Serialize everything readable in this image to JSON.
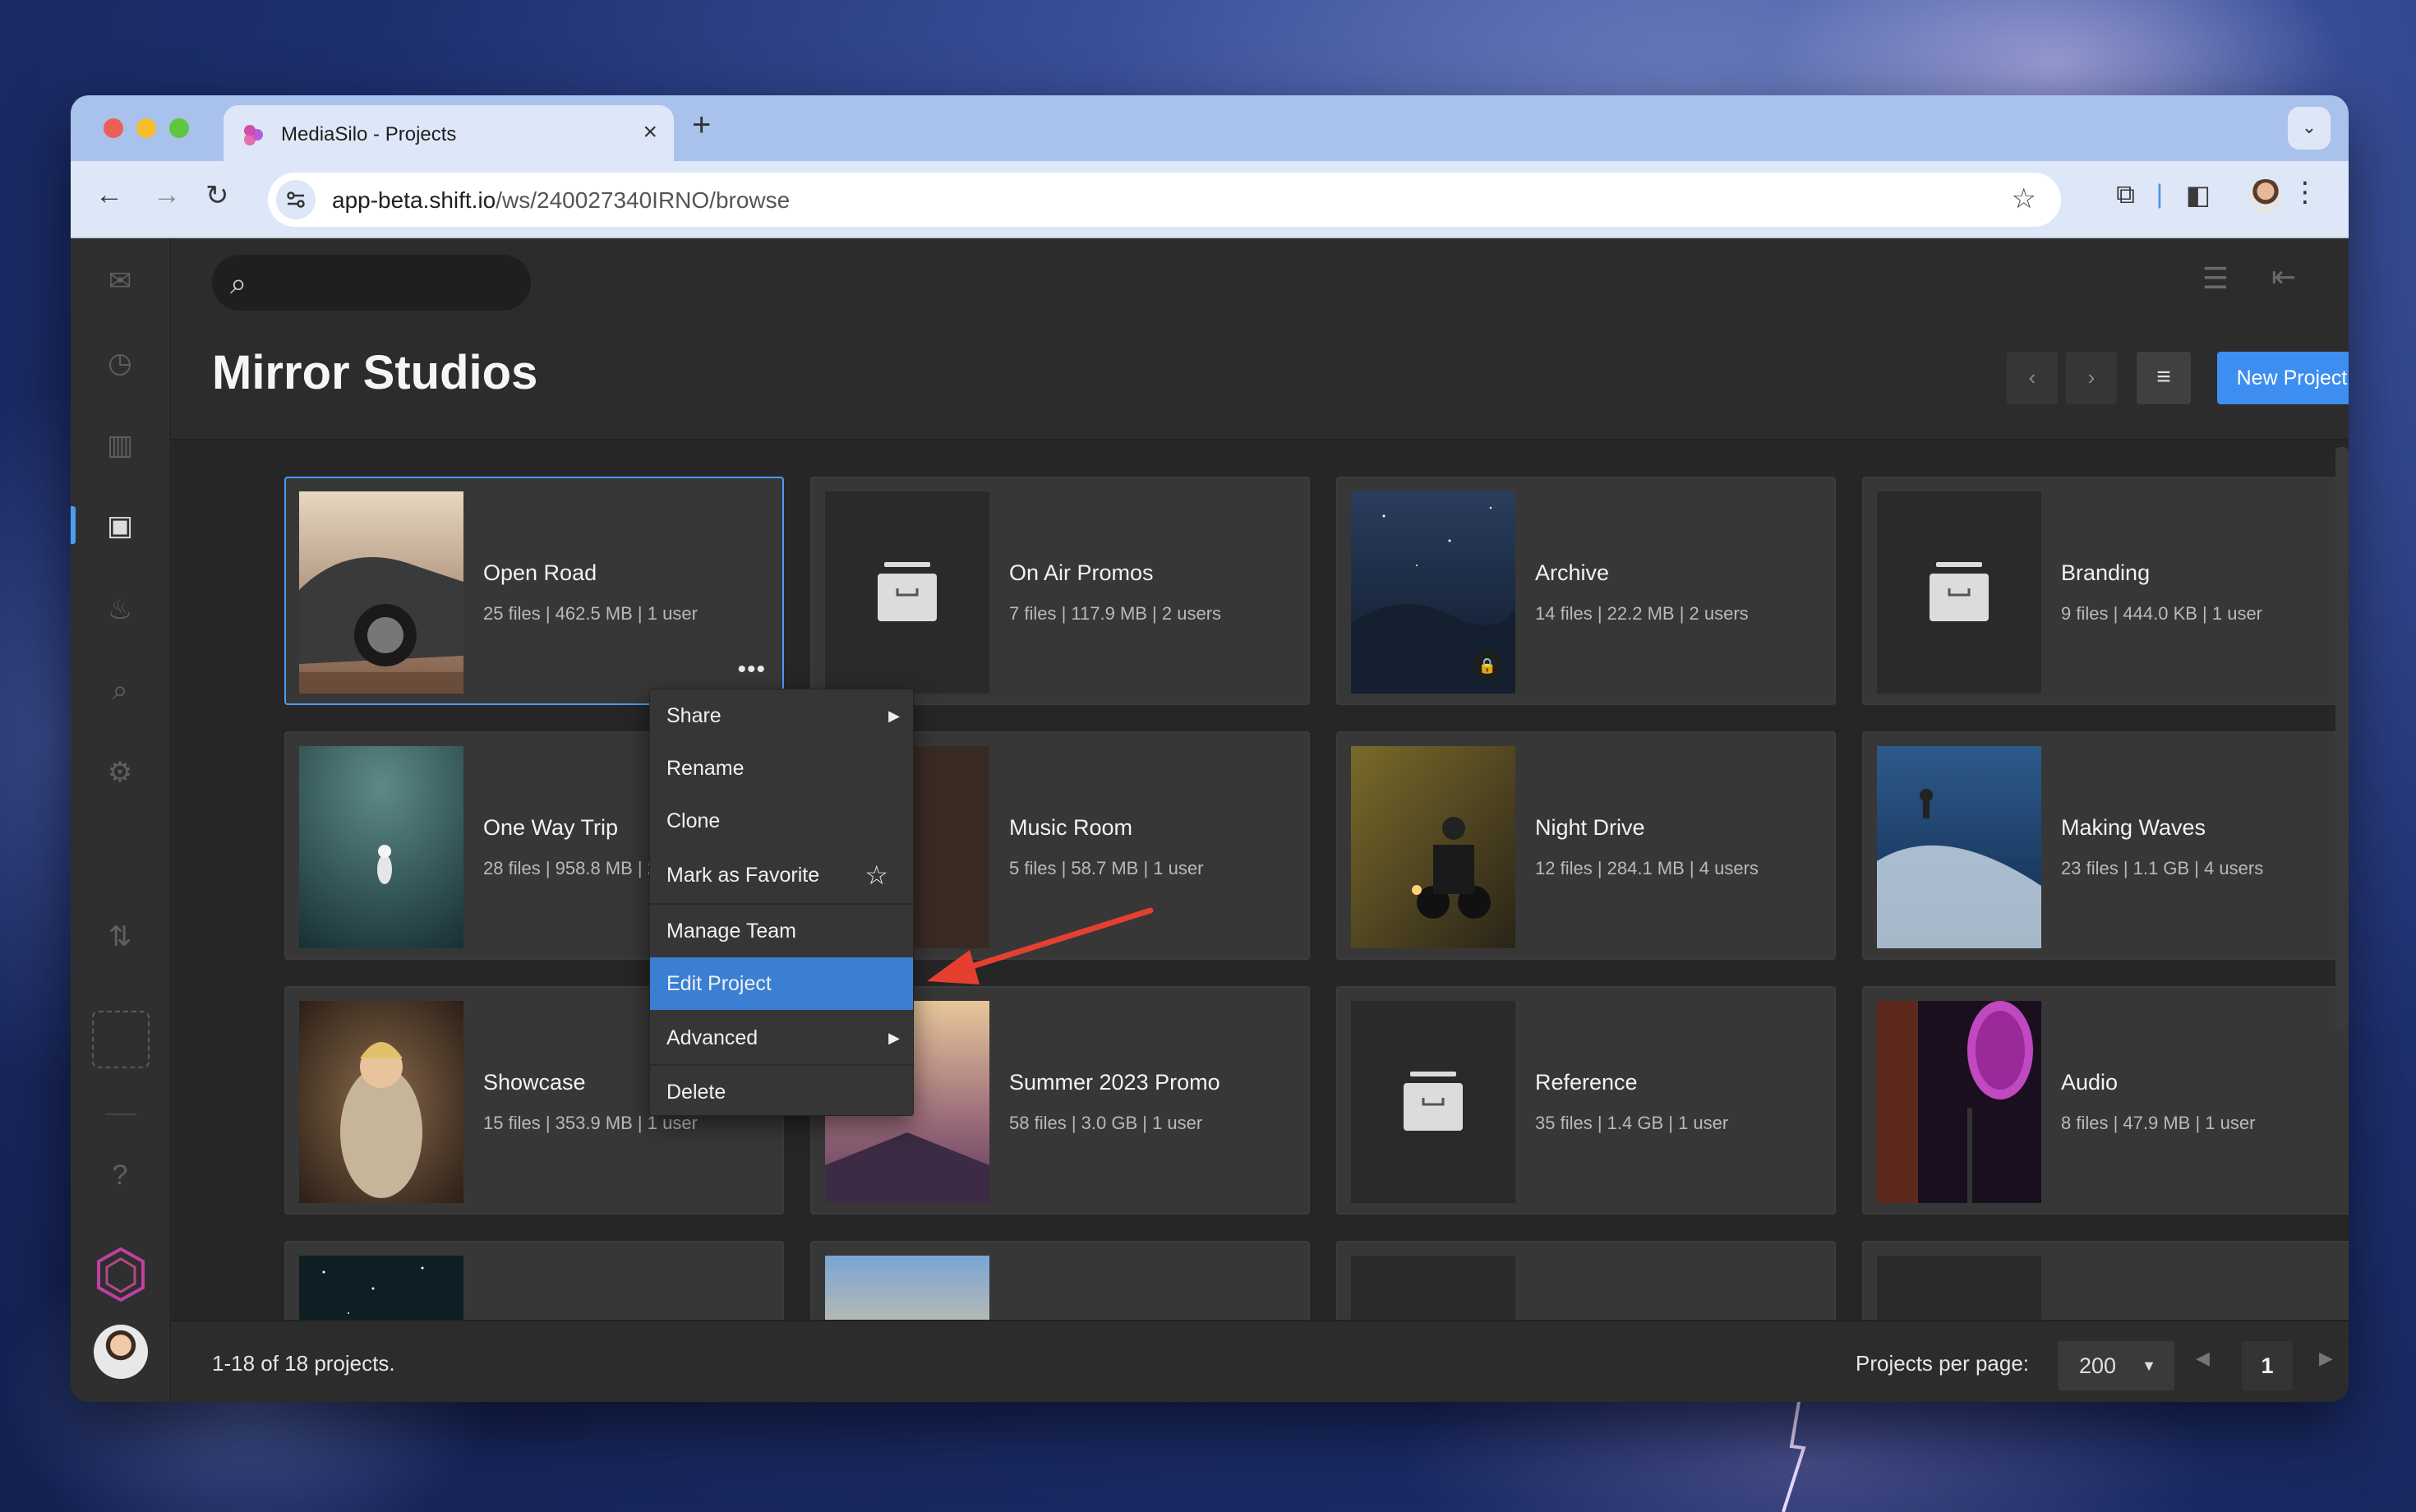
{
  "browser": {
    "tab_title": "MediaSilo - Projects",
    "url_host": "app-beta.shift.io",
    "url_path": "/ws/240027340IRNO/browse"
  },
  "header": {
    "title": "Mirror Studios",
    "new_project_label": "New Project"
  },
  "projects": [
    {
      "name": "Open Road",
      "meta": "25 files | 462.5 MB | 1 user",
      "thumb": "car"
    },
    {
      "name": "On Air Promos",
      "meta": "7 files | 117.9 MB | 2 users",
      "thumb": "folder"
    },
    {
      "name": "Archive",
      "meta": "14 files | 22.2 MB | 2 users",
      "thumb": "night-mountains",
      "locked": true
    },
    {
      "name": "Branding",
      "meta": "9 files | 444.0 KB | 1 user",
      "thumb": "folder"
    },
    {
      "name": "One Way Trip",
      "meta": "28 files | 958.8 MB | 2 users",
      "thumb": "astronaut"
    },
    {
      "name": "Music Room",
      "meta": "5 files | 58.7 MB | 1 user",
      "thumb": "dark"
    },
    {
      "name": "Night Drive",
      "meta": "12 files | 284.1 MB | 4 users",
      "thumb": "motorcycle"
    },
    {
      "name": "Making Waves",
      "meta": "23 files | 1.1 GB | 4 users",
      "thumb": "surf"
    },
    {
      "name": "Showcase",
      "meta": "15 files | 353.9 MB | 1 user",
      "thumb": "party"
    },
    {
      "name": "Summer 2023 Promo",
      "meta": "58 files | 3.0 GB | 1 user",
      "thumb": "clouds"
    },
    {
      "name": "Reference",
      "meta": "35 files | 1.4 GB | 1 user",
      "thumb": "folder"
    },
    {
      "name": "Audio",
      "meta": "8 files | 47.9 MB | 1 user",
      "thumb": "microphone"
    }
  ],
  "context_menu": {
    "items": [
      "Share",
      "Rename",
      "Clone",
      "Mark as Favorite",
      "Manage Team",
      "Edit Project",
      "Advanced",
      "Delete"
    ],
    "highlighted": "Edit Project"
  },
  "footer": {
    "count": "1-18 of 18 projects.",
    "per_page_label": "Projects per page:",
    "per_page_value": "200",
    "page": "1"
  },
  "colors": {
    "accent": "#3d8ef0",
    "menu_highlight": "#3a7fd4",
    "annotation_arrow": "#e5402f"
  }
}
